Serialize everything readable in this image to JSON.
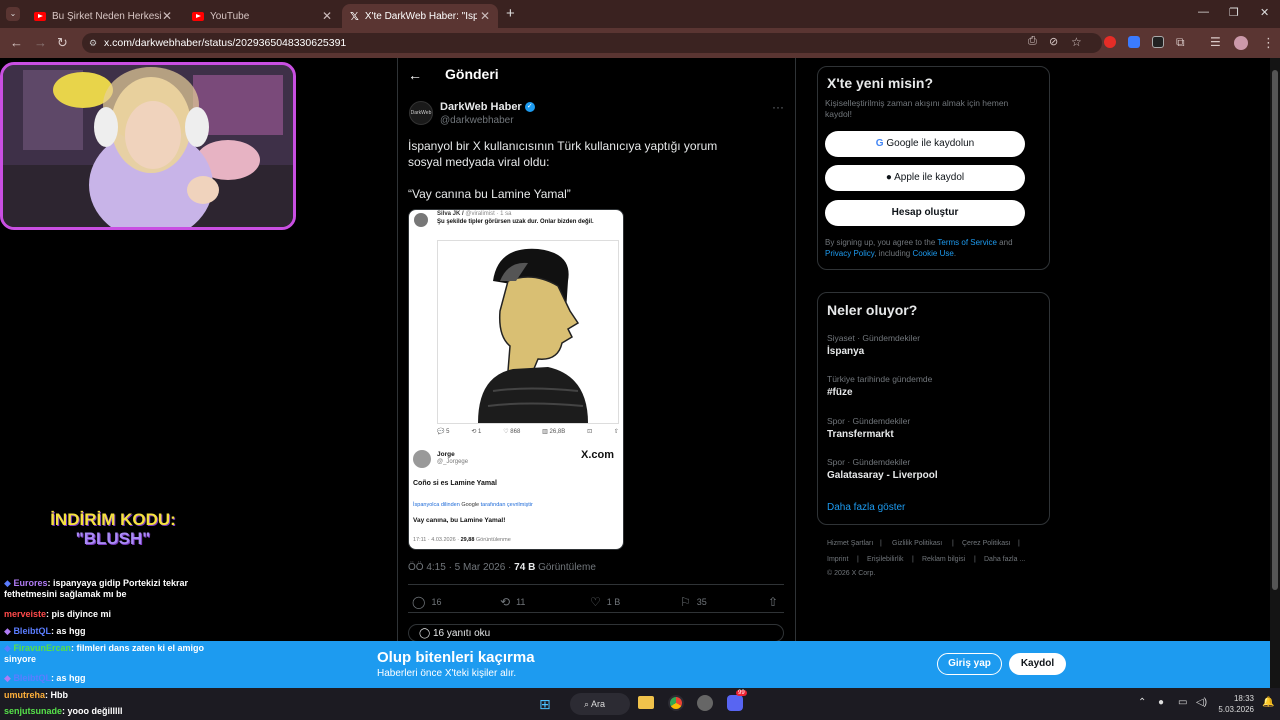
{
  "tabs": [
    {
      "label": "Bu Şirket Neden Herkesi Korkut"
    },
    {
      "label": "YouTube"
    },
    {
      "label": "X'te DarkWeb Haber: \"İspanyol"
    }
  ],
  "url": "x.com/darkwebhaber/status/2029365048330625391",
  "overlay": {
    "promo_line1": "İNDİRİM KODU:",
    "promo_line2": "\"BLUSH\"",
    "chat": [
      {
        "user": "Eurores",
        "text": ": ispanyaya gidip Portekizi tekrar fethetmesini sağlamak mı be",
        "color": "#b17cf5"
      },
      {
        "user": "merveiste",
        "text": ": pis diyince mi",
        "color": "#ff4a4a"
      },
      {
        "user": "BleibtQL",
        "text": ": as hgg",
        "color": "#5b7dff"
      },
      {
        "user": "FiravunErcan",
        "text": ": filmleri dans zaten ki el amigo sinyore",
        "color": "#56e04a"
      },
      {
        "user": "BleibtQL",
        "text": ": as hgg",
        "color": "#5b7dff"
      },
      {
        "user": "umutreha",
        "text": ": Hbb",
        "color": "#ffb03a"
      },
      {
        "user": "senjutsunade",
        "text": ": yooo değilllll",
        "color": "#56e04a"
      }
    ]
  },
  "post": {
    "header": "Gönderi",
    "author_name": "DarkWeb Haber",
    "author_handle": "@darkwebhaber",
    "avatar_text": "DarkWeb",
    "text_line1": "İspanyol bir X kullanıcısının Türk kullanıcıya yaptığı yorum sosyal medyada viral oldu:",
    "text_line2": "“Vay canına bu Lamine Yamal”",
    "meta_time": "ÖÖ 4:15 · 5 Mar 2026 · ",
    "meta_views": "74 B",
    "meta_views_label": " Görüntüleme",
    "replies": "16",
    "reposts": "11",
    "likes": "1 B",
    "bookmarks": "35",
    "read_replies": "16 yanıtı oku"
  },
  "embed": {
    "quoted_user": "Silva JK / ",
    "quoted_handle": "@viralimist · 1 sa",
    "quoted_text": "Şu şekilde tipler görürsen uzak dur. Onlar bizden değil.",
    "stats": [
      "5",
      "1",
      "868",
      "26,8B"
    ],
    "reply_name": "Jorge",
    "reply_handle": "@_Jorgege",
    "brand": "X.com",
    "reply_text": "Coño si es Lamine Yamal",
    "translated_prefix": "İspanyolca dilinden",
    "translated_google": "Google",
    "translated_suffix": "tarafından çevrilmiştir",
    "translation": "Vay canına, bu Lamine Yamal!",
    "footer_time": "17:11 · 4.03.2026 · ",
    "footer_views": "29,88",
    "footer_views_label": " Görüntülenme"
  },
  "signup": {
    "title": "X'te yeni misin?",
    "subtitle": "Kişiselleştirilmiş zaman akışını almak için hemen kaydol!",
    "google": "Google ile kaydolun",
    "apple": "Apple ile kaydol",
    "create": "Hesap oluştur",
    "legal_1": "By signing up, you agree to the ",
    "tos": "Terms of Service",
    "legal_2": " and ",
    "privacy": "Privacy Policy",
    "legal_3": ", including ",
    "cookie": "Cookie Use",
    "legal_4": "."
  },
  "trends": {
    "title": "Neler oluyor?",
    "items": [
      {
        "context": "Siyaset · Gündemdekiler",
        "topic": "İspanya"
      },
      {
        "context": "Türkiye tarihinde gündemde",
        "topic": "#füze"
      },
      {
        "context": "Spor · Gündemdekiler",
        "topic": "Transfermarkt"
      },
      {
        "context": "Spor · Gündemdekiler",
        "topic": "Galatasaray - Liverpool"
      }
    ],
    "more": "Daha fazla göster"
  },
  "footer_links": [
    "Hizmet Şartları",
    "Gizlilik Politikası",
    "Çerez Politikası",
    "Imprint",
    "Erişilebilirlik",
    "Reklam bilgisi",
    "Daha fazla ...",
    "© 2026 X Corp."
  ],
  "banner": {
    "title": "Olup bitenleri kaçırma",
    "subtitle": "Haberleri önce X'teki kişiler alır.",
    "login": "Giriş yap",
    "signup": "Kaydol"
  },
  "taskbar": {
    "search": "Ara",
    "time": "18:33",
    "date": "5.03.2026",
    "badge": "99"
  }
}
